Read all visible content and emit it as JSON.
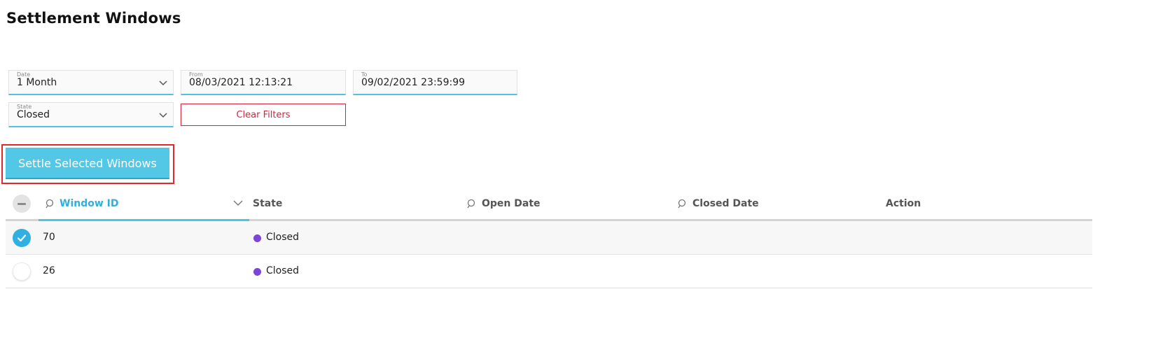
{
  "page": {
    "title": "Settlement Windows"
  },
  "filters": {
    "date": {
      "label": "Date",
      "value": "1 Month"
    },
    "from": {
      "label": "From",
      "value": "08/03/2021 12:13:21"
    },
    "to": {
      "label": "To",
      "value": "09/02/2021 23:59:99"
    },
    "state": {
      "label": "State",
      "value": "Closed"
    },
    "clear_label": "Clear Filters"
  },
  "actions": {
    "settle_label": "Settle Selected Windows"
  },
  "table": {
    "columns": [
      {
        "label": "Window ID",
        "searchable": true,
        "sorted": true
      },
      {
        "label": "State",
        "searchable": false
      },
      {
        "label": "Open Date",
        "searchable": true
      },
      {
        "label": "Closed Date",
        "searchable": true
      },
      {
        "label": "Action",
        "searchable": false
      }
    ],
    "rows": [
      {
        "id": "70",
        "state": "Closed",
        "selected": true,
        "open_date": "",
        "closed_date": "",
        "action": ""
      },
      {
        "id": "26",
        "state": "Closed",
        "selected": false,
        "open_date": "",
        "closed_date": "",
        "action": ""
      }
    ]
  },
  "colors": {
    "accent": "#4fc3e0",
    "settle_button": "#52c8e6",
    "danger": "#d6243c",
    "state_closed": "#7b45d6",
    "checkbox_on": "#2fb0e0"
  }
}
